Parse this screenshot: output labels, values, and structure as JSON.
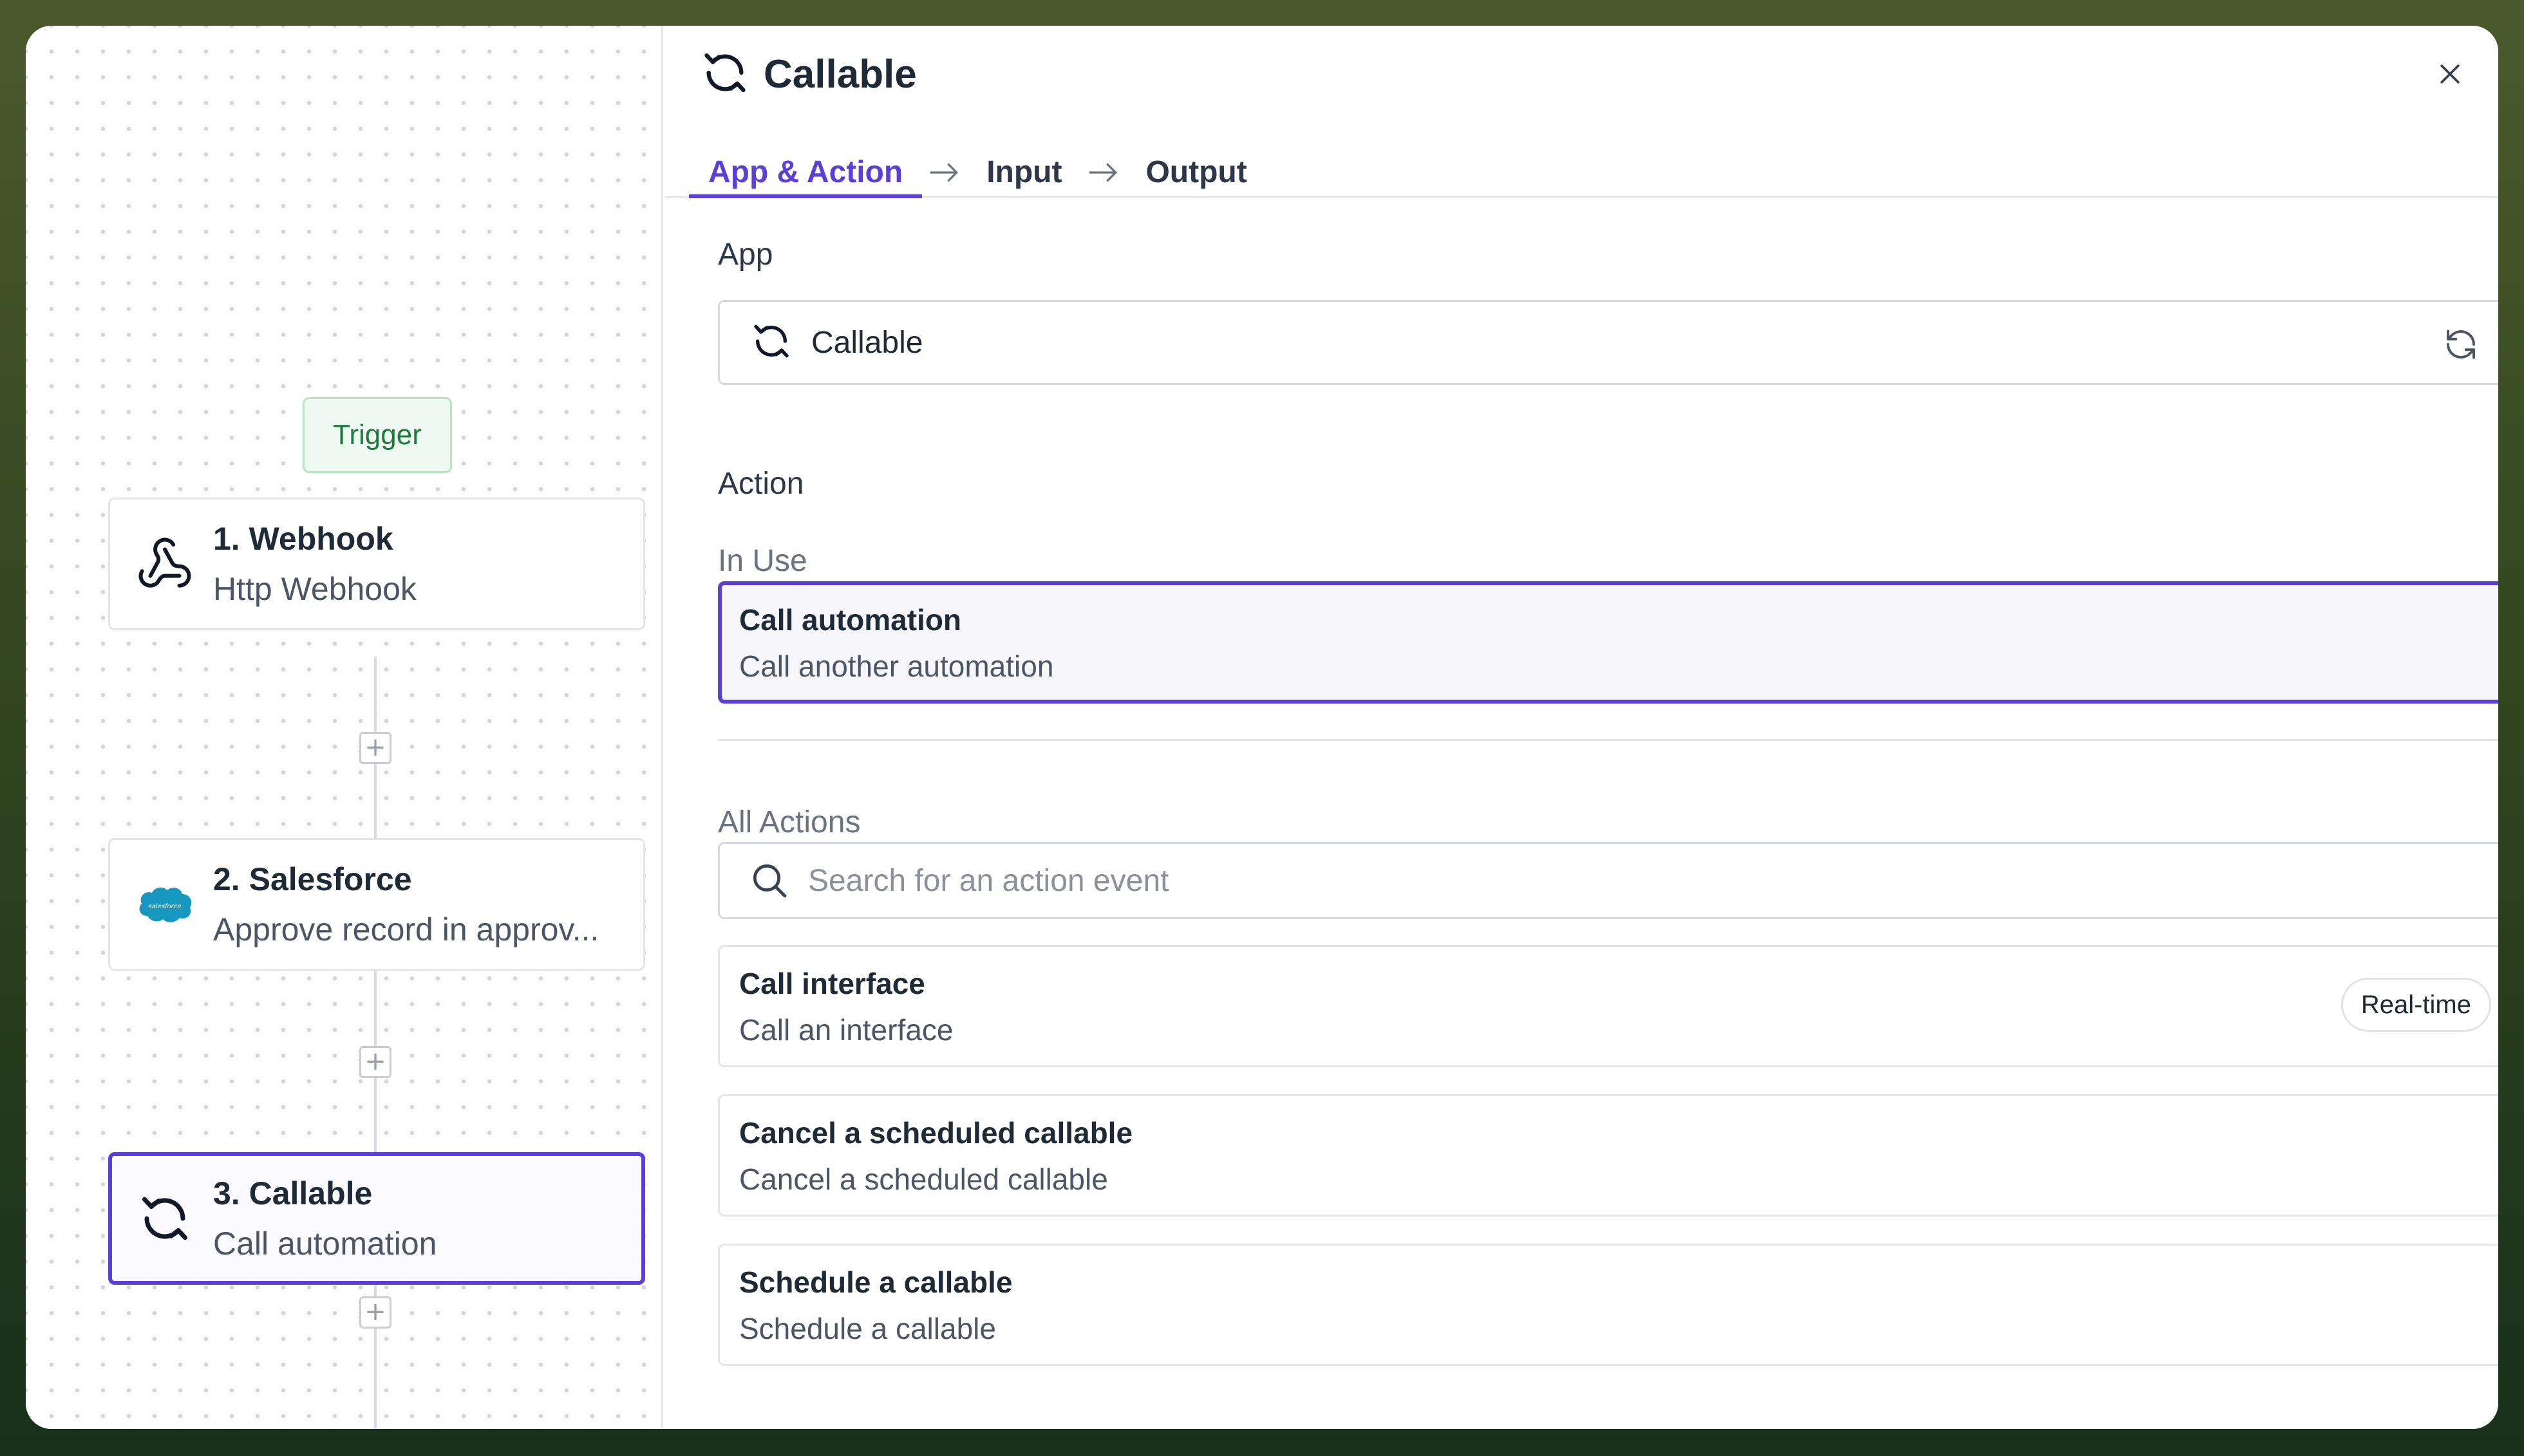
{
  "canvas": {
    "trigger_label": "Trigger",
    "steps": [
      {
        "title": "1. Webhook",
        "subtitle": "Http Webhook",
        "icon": "webhook-icon"
      },
      {
        "title": "2. Salesforce",
        "subtitle": "Approve record in approv...",
        "icon": "salesforce-logo"
      },
      {
        "title": "3. Callable",
        "subtitle": "Call automation",
        "icon": "sync-icon"
      }
    ],
    "add_step_symbol": "+"
  },
  "panel": {
    "title": "Callable",
    "tabs": [
      {
        "label": "App & Action",
        "active": true
      },
      {
        "label": "Input",
        "active": false
      },
      {
        "label": "Output",
        "active": false
      }
    ],
    "app_section_label": "App",
    "app_selected": "Callable",
    "action_section_label": "Action",
    "in_use_label": "In Use",
    "in_use_action": {
      "title": "Call automation",
      "subtitle": "Call another automation"
    },
    "all_actions_label": "All Actions",
    "search_placeholder": "Search for an action event",
    "actions": [
      {
        "title": "Call interface",
        "subtitle": "Call an interface",
        "badge": "Real-time"
      },
      {
        "title": "Cancel a scheduled callable",
        "subtitle": "Cancel a scheduled callable"
      },
      {
        "title": "Schedule a callable",
        "subtitle": "Schedule a callable"
      }
    ]
  },
  "colors": {
    "accent": "#5b3fd6",
    "trigger_bg": "#eefaf1",
    "trigger_text": "#1f7a3d",
    "salesforce_blue": "#1798c1",
    "frame_top": "#4a5a2c",
    "frame_bottom": "#16301a"
  }
}
